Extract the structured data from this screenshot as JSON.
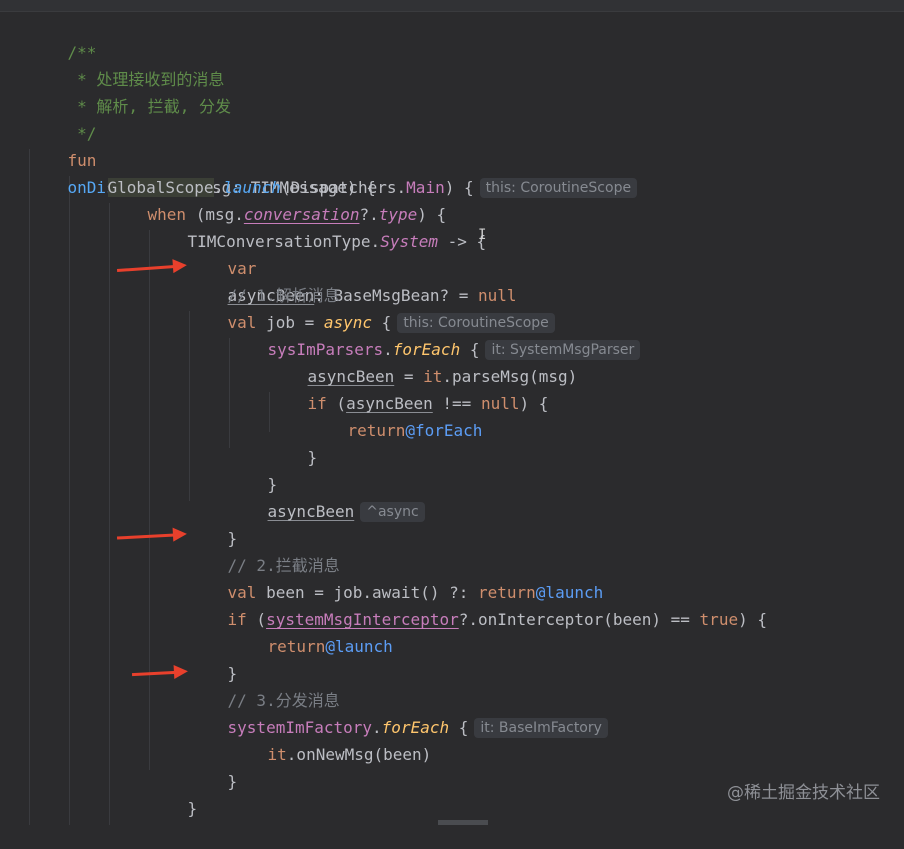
{
  "doc": {
    "open": "/**",
    "line1": " * 处理接收到的消息",
    "line2": " * 解析, 拦截, 分发",
    "close": " */"
  },
  "fun": {
    "kw": "fun",
    "name": "onDispatchMsg",
    "params": "(msg: TIMMessage) {"
  },
  "launch": {
    "scope": "GlobalScope",
    "dot": ".",
    "fn": "launch",
    "args": "(Dispatchers.",
    "main": "Main",
    "tail": ") {",
    "hint": "this: CoroutineScope"
  },
  "when": {
    "kw": "when",
    "open": " (msg.",
    "conv": "conversation",
    "safe": "?.",
    "type": "type",
    "tail": ") {"
  },
  "branch": {
    "obj": "TIMConversationType.",
    "sys": "System",
    "tail": " -> {"
  },
  "var_line": {
    "kw": "var",
    "name": "asyncBeen",
    "type": ": BaseMsgBean? = ",
    "null": "null"
  },
  "comments": {
    "c1": "// 1.解析消息",
    "c2": "// 2.拦截消息",
    "c3": "// 3.分发消息"
  },
  "job": {
    "kw": "val",
    "rest": " job = ",
    "async": "async",
    "brace": " {",
    "hint": "this: CoroutineScope"
  },
  "parsers": {
    "name": "sysImParsers",
    "dot": ".",
    "fn": "forEach",
    "brace": " {",
    "hint": "it: SystemMsgParser"
  },
  "assign": {
    "var": "asyncBeen",
    "rest": " = ",
    "it": "it",
    "call": ".parseMsg(msg)"
  },
  "ifnull": {
    "kw": "if",
    "open": " (",
    "var": "asyncBeen",
    "op": " !== ",
    "null": "null",
    "tail": ") {"
  },
  "ret1": {
    "kw": "return",
    "lbl": "@forEach"
  },
  "close1": "}",
  "close2": "}",
  "asyncret": {
    "var": "asyncBeen",
    "hint": "^async"
  },
  "close3": "}",
  "been": {
    "kw": "val",
    "rest": " been = job.await() ?: ",
    "ret": "return",
    "lbl": "@launch"
  },
  "intercept": {
    "kw": "if",
    "open": " (",
    "var": "systemMsgInterceptor",
    "rest": "?.onInterceptor(been) == ",
    "true": "true",
    "tail": ") {"
  },
  "ret2": {
    "kw": "return",
    "lbl": "@launch"
  },
  "close4": "}",
  "factory": {
    "name": "systemImFactory",
    "dot": ".",
    "fn": "forEach",
    "brace": " {",
    "hint": "it: BaseImFactory"
  },
  "newmsg": {
    "it": "it",
    "call": ".onNewMsg(been)"
  },
  "close5": "}",
  "close6": "}",
  "cursor_glyph": "I",
  "watermark": "@稀土掘金技术社区",
  "colors": {
    "background": "#2b2b2d",
    "keyword": "#cf8e6d",
    "function": "#56a8f5",
    "doc_comment": "#5f8c4a",
    "comment": "#7a7e85",
    "property": "#c77dbb",
    "arrow": "#e8402c"
  }
}
